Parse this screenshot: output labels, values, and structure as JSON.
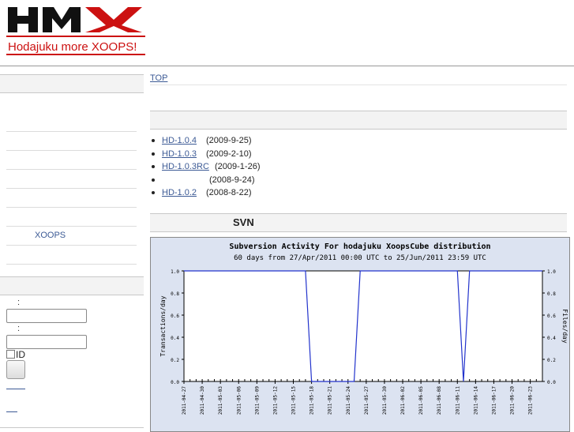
{
  "logo": {
    "mark": "HMX",
    "tagline": "Hodajuku more XOOPS!",
    "accent": "#cc1111"
  },
  "nav": {
    "top_link": "TOP"
  },
  "sidebar": {
    "menu_items": [
      "",
      "",
      "",
      "",
      "",
      "",
      "",
      "XOOPS",
      ""
    ],
    "login": {
      "user_label": ":",
      "pass_label": ":",
      "remember_label": "ID"
    }
  },
  "releases": [
    {
      "version": "HD-1.0.4",
      "date": "(2009-9-25)"
    },
    {
      "version": "HD-1.0.3",
      "date": "(2009-2-10)"
    },
    {
      "version": "HD-1.0.3RC",
      "date": "(2009-1-26)"
    },
    {
      "version": "",
      "date": "(2008-9-24)"
    },
    {
      "version": "HD-1.0.2",
      "date": "(2008-8-22)"
    }
  ],
  "svn": {
    "title": "SVN"
  },
  "chart_data": {
    "type": "line",
    "title": "Subversion Activity For hodajuku XoopsCube distribution",
    "subtitle": "60 days from 27/Apr/2011 00:00 UTC to 25/Jun/2011 23:59 UTC",
    "ylabel": "Transactions/day",
    "ylabel_right": "Files/day",
    "ylim": [
      0,
      1.0
    ],
    "yticks": [
      "0.0",
      "0.2",
      "0.4",
      "0.6",
      "0.8",
      "1.0"
    ],
    "xlim": [
      "2011-04-27",
      "2011-06-25"
    ],
    "xticks": [
      "2011-04-27",
      "2011-04-30",
      "2011-05-03",
      "2011-05-06",
      "2011-05-09",
      "2011-05-12",
      "2011-05-15",
      "2011-05-18",
      "2011-05-21",
      "2011-05-24",
      "2011-05-27",
      "2011-05-30",
      "2011-06-02",
      "2011-06-05",
      "2011-06-08",
      "2011-06-11",
      "2011-06-14",
      "2011-06-17",
      "2011-06-20",
      "2011-06-23"
    ],
    "series": [
      {
        "color": "#2233cc",
        "x": [
          "2011-04-27",
          "2011-05-17",
          "2011-05-18",
          "2011-05-25",
          "2011-05-26",
          "2011-06-11",
          "2011-06-12",
          "2011-06-13",
          "2011-06-25"
        ],
        "y": [
          1.0,
          1.0,
          0.0,
          0.0,
          1.0,
          1.0,
          0.0,
          1.0,
          1.0
        ]
      }
    ],
    "grid": false
  }
}
